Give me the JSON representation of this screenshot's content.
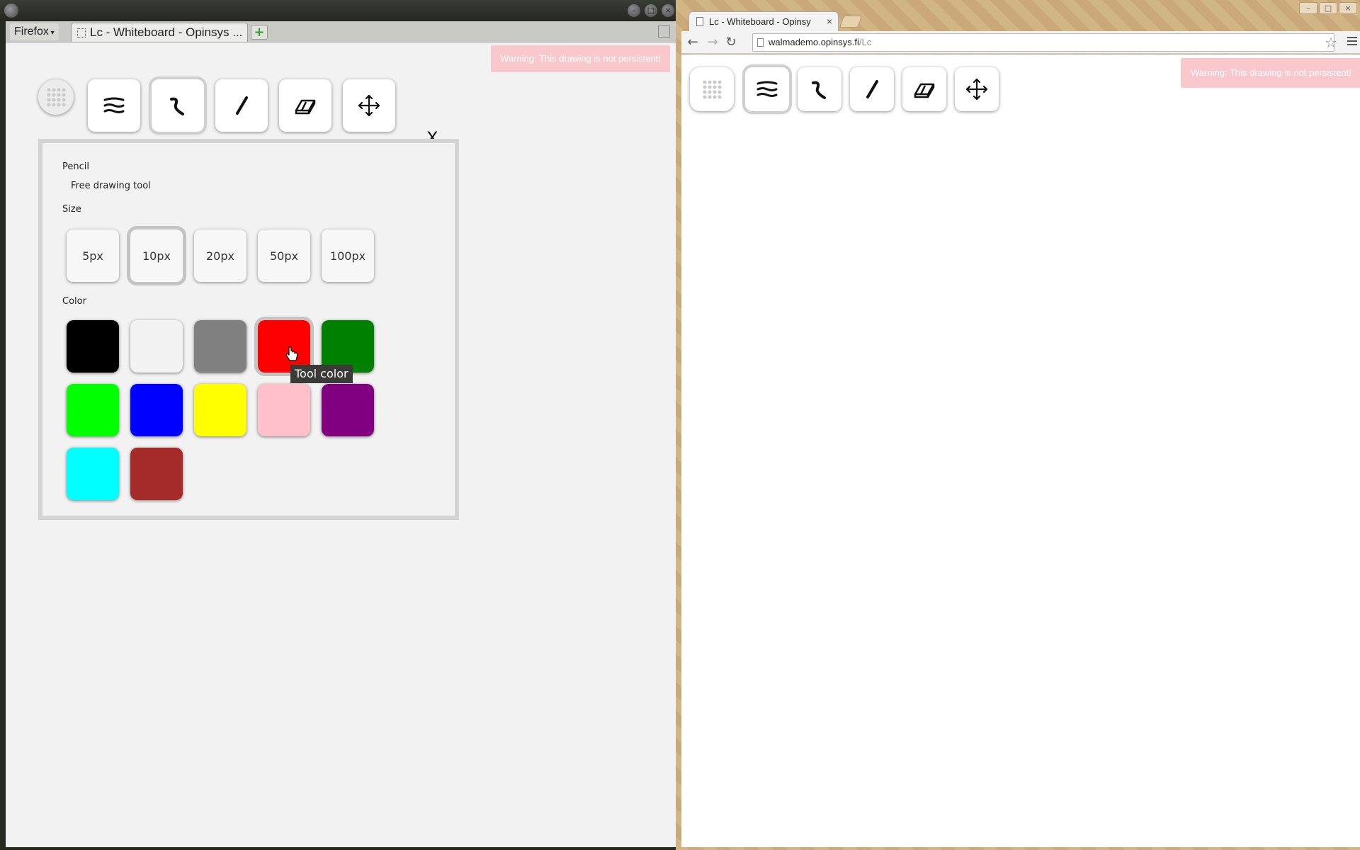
{
  "firefox": {
    "menu_label": "Firefox",
    "tab_title": "Lc - Whiteboard - Opinsys ...",
    "new_tab_symbol": "+",
    "window_buttons": [
      "–",
      "□",
      "×"
    ]
  },
  "whiteboard": {
    "warning": "Warning: This drawing is not persistent!",
    "toolbar_icons": [
      "dots-grid-icon",
      "menu-lines-icon",
      "pencil-curve-icon",
      "line-icon",
      "eraser-icon",
      "move-arrows-icon"
    ],
    "active_tool": "pencil-curve-icon"
  },
  "panel": {
    "close_label": "X",
    "tool_name": "Pencil",
    "tool_description": "Free drawing tool",
    "size_heading": "Size",
    "sizes": [
      "5px",
      "10px",
      "20px",
      "50px",
      "100px"
    ],
    "selected_size": "10px",
    "color_heading": "Color",
    "colors": [
      "#000000",
      "#f2f2f2",
      "#808080",
      "#ff0000",
      "#008000",
      "#00ff00",
      "#0000ff",
      "#ffff00",
      "#ffc0cb",
      "#800080",
      "#00ffff",
      "#a52a2a"
    ],
    "selected_color": "#ff0000",
    "tooltip": "Tool color"
  },
  "chrome": {
    "tab_title": "Lc - Whiteboard - Opinsy",
    "tab_close": "×",
    "url_host": "walmademo.opinsys.fi",
    "url_path": "/Lc",
    "window_buttons": [
      "–",
      "□",
      "×"
    ]
  }
}
